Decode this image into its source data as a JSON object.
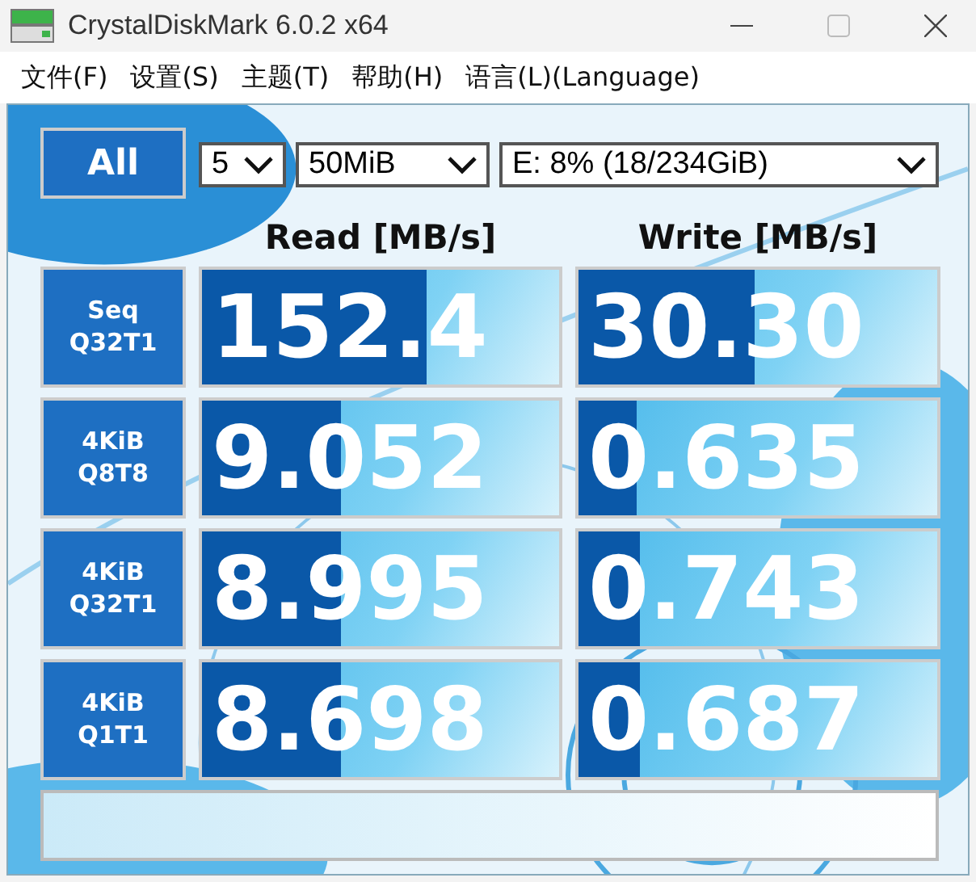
{
  "window": {
    "title": "CrystalDiskMark 6.0.2 x64"
  },
  "menu": [
    "文件(F)",
    "设置(S)",
    "主题(T)",
    "帮助(H)",
    "语言(L)(Language)"
  ],
  "all_button": "All",
  "selectors": [
    {
      "kind": "count",
      "value": "5"
    },
    {
      "kind": "size",
      "value": "50MiB"
    },
    {
      "kind": "drive",
      "value": "E: 8% (18/234GiB)"
    }
  ],
  "columns": [
    "Read [MB/s]",
    "Write [MB/s]"
  ],
  "tests": [
    {
      "label": [
        "Seq",
        "Q32T1"
      ],
      "read": {
        "value": "152.4",
        "level": 0.63
      },
      "write": {
        "value": "30.30",
        "level": 0.49
      }
    },
    {
      "label": [
        "4KiB",
        "Q8T8"
      ],
      "read": {
        "value": "9.052",
        "level": 0.39
      },
      "write": {
        "value": "0.635",
        "level": 0.16
      }
    },
    {
      "label": [
        "4KiB",
        "Q32T1"
      ],
      "read": {
        "value": "8.995",
        "level": 0.39
      },
      "write": {
        "value": "0.743",
        "level": 0.17
      }
    },
    {
      "label": [
        "4KiB",
        "Q1T1"
      ],
      "read": {
        "value": "8.698",
        "level": 0.39
      },
      "write": {
        "value": "0.687",
        "level": 0.17
      }
    }
  ]
}
